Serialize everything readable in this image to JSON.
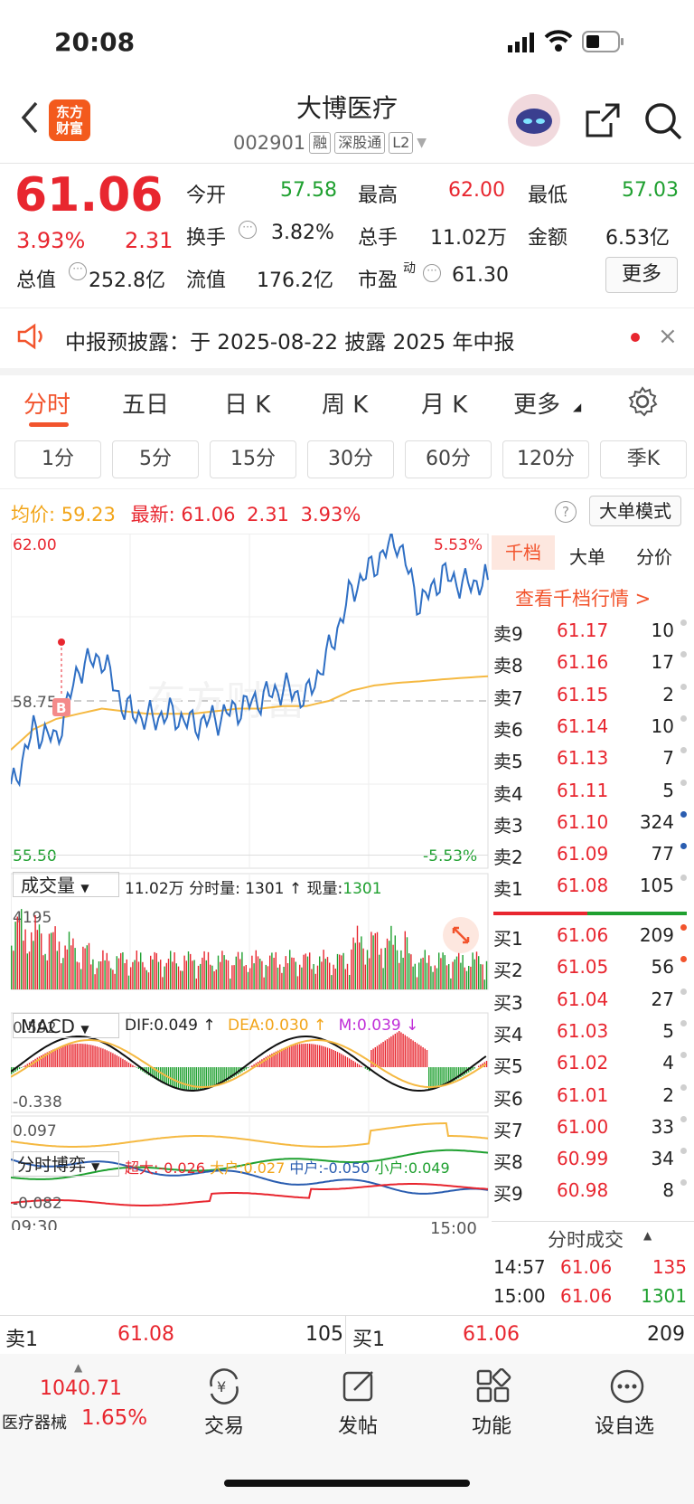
{
  "status_bar": {
    "time": "20:08"
  },
  "header": {
    "logo_text_1": "东方",
    "logo_text_2": "财富",
    "title": "大博医疗",
    "code": "002901",
    "tags": [
      "融",
      "深股通",
      "L2"
    ]
  },
  "quote": {
    "price": "61.06",
    "change_pct": "3.93%",
    "change": "2.31",
    "fields": [
      {
        "label": "今开",
        "value": "57.58",
        "color": "green"
      },
      {
        "label": "最高",
        "value": "62.00",
        "color": "red"
      },
      {
        "label": "最低",
        "value": "57.03",
        "color": "green"
      },
      {
        "label": "换手",
        "value": "3.82%",
        "color": "dark"
      },
      {
        "label": "总手",
        "value": "11.02万",
        "color": "dark"
      },
      {
        "label": "金额",
        "value": "6.53亿",
        "color": "dark"
      },
      {
        "label": "总值",
        "value": "252.8亿",
        "color": "dark"
      },
      {
        "label": "流值",
        "value": "176.2亿",
        "color": "dark"
      },
      {
        "label": "市盈",
        "value": "61.30",
        "color": "dark",
        "sup": "动"
      }
    ],
    "more_label": "更多"
  },
  "notice": {
    "text": "中报预披露：于 2025-08-22 披露 2025 年中报"
  },
  "tabs": [
    "分时",
    "五日",
    "日 K",
    "周 K",
    "月 K",
    "更多"
  ],
  "active_tab": 0,
  "periods": [
    "1分",
    "5分",
    "15分",
    "30分",
    "60分",
    "120分",
    "季K"
  ],
  "info": {
    "avg_label": "均价:",
    "avg_value": "59.23",
    "latest_label": "最新:",
    "latest_value": "61.06",
    "latest_change": "2.31",
    "latest_pct": "3.93%",
    "mode_label": "大单模式"
  },
  "price_chart": {
    "y_top": "62.00",
    "y_mid": "58.75",
    "y_bottom": "55.50",
    "pct_top": "5.53%",
    "pct_bottom": "-5.53%",
    "marker": "B",
    "watermark": "东方财富",
    "colors": {
      "price": "#2f6fc4",
      "avg": "#f5b942"
    }
  },
  "volume_panel": {
    "selector": "成交量",
    "total": "11.02万",
    "bar_label": "分时量: 1301 ↑",
    "now_label": "现量:",
    "now_value": "1301",
    "max_label": "4195"
  },
  "macd_panel": {
    "selector": "MACD",
    "dif": "DIF:0.049 ↑",
    "dea": "DEA:0.030 ↑",
    "m": "M:0.039 ↓",
    "y_top": "0.592",
    "y_bottom": "-0.338"
  },
  "flow_panel": {
    "selector": "分时博弈",
    "super_large": "超大:-0.026",
    "large": "大户:0.027",
    "medium": "中户:-0.050",
    "small": "小户:0.049",
    "y_top": "0.097",
    "y_bottom": "-0.082",
    "time_start": "09:30",
    "time_end": "15:00"
  },
  "order_book": {
    "subtabs": [
      "千档",
      "大单",
      "分价"
    ],
    "link": "查看千档行情 >",
    "asks": [
      {
        "label": "卖9",
        "price": "61.17",
        "qty": "10",
        "dot": "gray"
      },
      {
        "label": "卖8",
        "price": "61.16",
        "qty": "17",
        "dot": "gray"
      },
      {
        "label": "卖7",
        "price": "61.15",
        "qty": "2",
        "dot": "gray"
      },
      {
        "label": "卖6",
        "price": "61.14",
        "qty": "10",
        "dot": "gray"
      },
      {
        "label": "卖5",
        "price": "61.13",
        "qty": "7",
        "dot": "gray"
      },
      {
        "label": "卖4",
        "price": "61.11",
        "qty": "5",
        "dot": "gray"
      },
      {
        "label": "卖3",
        "price": "61.10",
        "qty": "324",
        "dot": "blue"
      },
      {
        "label": "卖2",
        "price": "61.09",
        "qty": "77",
        "dot": "blue"
      },
      {
        "label": "卖1",
        "price": "61.08",
        "qty": "105",
        "dot": "gray"
      }
    ],
    "bids": [
      {
        "label": "买1",
        "price": "61.06",
        "qty": "209",
        "dot": "orange"
      },
      {
        "label": "买2",
        "price": "61.05",
        "qty": "56",
        "dot": "orange"
      },
      {
        "label": "买3",
        "price": "61.04",
        "qty": "27",
        "dot": "gray"
      },
      {
        "label": "买4",
        "price": "61.03",
        "qty": "5",
        "dot": "gray"
      },
      {
        "label": "买5",
        "price": "61.02",
        "qty": "4",
        "dot": "gray"
      },
      {
        "label": "买6",
        "price": "61.01",
        "qty": "2",
        "dot": "gray"
      },
      {
        "label": "买7",
        "price": "61.00",
        "qty": "33",
        "dot": "gray"
      },
      {
        "label": "买8",
        "price": "60.99",
        "qty": "34",
        "dot": "gray"
      },
      {
        "label": "买9",
        "price": "60.98",
        "qty": "8",
        "dot": "gray"
      }
    ],
    "trades_title": "分时成交",
    "trades": [
      {
        "time": "14:57",
        "price": "61.06",
        "qty": "135",
        "color": "red"
      },
      {
        "time": "15:00",
        "price": "61.06",
        "qty": "1301",
        "color": "green"
      }
    ]
  },
  "bottom_book": {
    "ask_label": "卖1",
    "ask_price": "61.08",
    "ask_qty": "105",
    "bid_label": "买1",
    "bid_price": "61.06",
    "bid_qty": "209"
  },
  "navbar": {
    "index_value": "1040.71",
    "index_name": "医疗器械",
    "index_pct": "1.65%",
    "items": [
      "交易",
      "发帖",
      "功能",
      "设自选"
    ]
  },
  "chart_data": {
    "type": "line",
    "x": [
      "09:30",
      "15:00"
    ],
    "ylim": [
      55.5,
      62.0
    ],
    "series": [
      {
        "name": "最新",
        "values": [
          57.0,
          58.2,
          58.0,
          59.4,
          59.6,
          58.6,
          58.4,
          58.5,
          58.3,
          58.4,
          58.6,
          58.8,
          59.0,
          58.8,
          59.7,
          60.9,
          61.4,
          61.9,
          60.6,
          61.2,
          61.0,
          61.1
        ]
      },
      {
        "name": "均价",
        "values": [
          57.8,
          58.2,
          58.4,
          58.5,
          58.6,
          58.55,
          58.5,
          58.5,
          58.5,
          58.55,
          58.6,
          58.6,
          58.65,
          58.65,
          58.75,
          58.95,
          59.05,
          59.1,
          59.13,
          59.17,
          59.2,
          59.23
        ]
      }
    ]
  }
}
